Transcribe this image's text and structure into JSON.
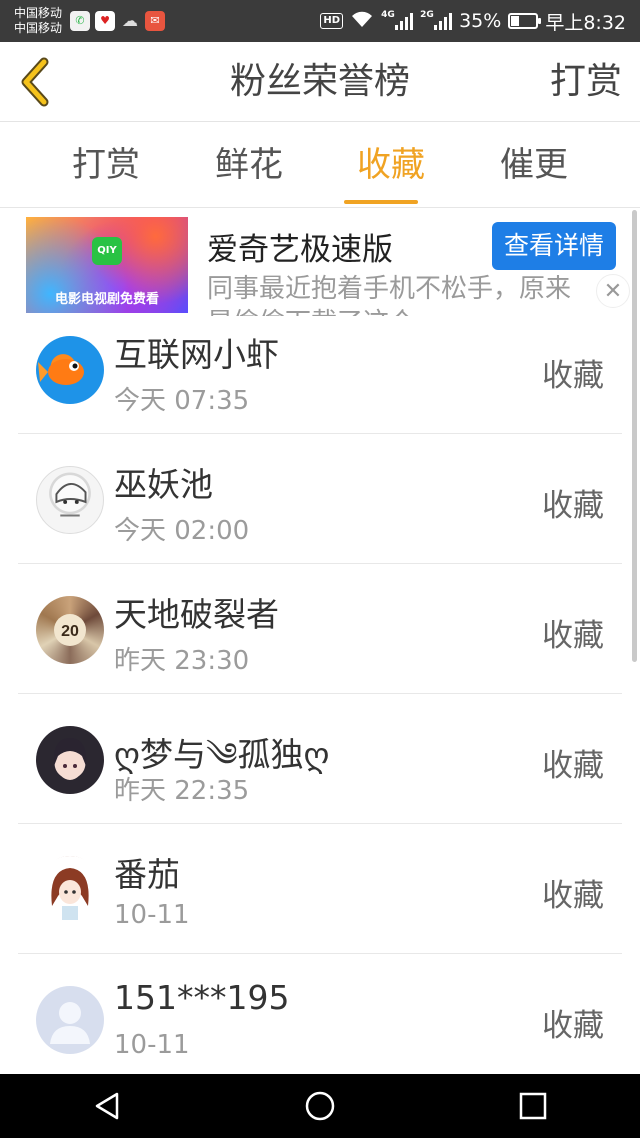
{
  "status_bar": {
    "carrier_1": "中国移动",
    "carrier_2": "中国移动",
    "app_icons": [
      "wechat-icon",
      "heart-icon",
      "cloud-icon",
      "mail-icon"
    ],
    "hd": "HD",
    "net_1": "4G",
    "net_2": "2G",
    "battery": "35%",
    "battery_level": 0.35,
    "time": "早上8:32"
  },
  "header": {
    "title": "粉丝荣誉榜",
    "action": "打赏"
  },
  "tabs": [
    {
      "label": "打赏",
      "active": false
    },
    {
      "label": "鲜花",
      "active": false
    },
    {
      "label": "收藏",
      "active": true
    },
    {
      "label": "催更",
      "active": false
    }
  ],
  "ad": {
    "title": "爱奇艺极速版",
    "cta": "查看详情",
    "desc_line_1": "同事最近抱着手机不松手，原来",
    "desc_line_2": "是偷偷下载了这个",
    "image_logo": "QIY",
    "image_caption": "电影电视剧免费看"
  },
  "list": [
    {
      "name": "互联网小虾",
      "time": "今天 07:35",
      "action": "收藏",
      "avatar": "fish"
    },
    {
      "name": "巫妖池",
      "time": "今天 02:00",
      "action": "收藏",
      "avatar": "sketch"
    },
    {
      "name": "天地破裂者",
      "time": "昨天 23:30",
      "action": "收藏",
      "avatar": "collage"
    },
    {
      "name": "ღ梦与༄孤独ღ",
      "time": "昨天 22:35",
      "action": "收藏",
      "avatar": "girl"
    },
    {
      "name": "番茄",
      "time": "10-11",
      "action": "收藏",
      "avatar": "chibi"
    },
    {
      "name": "151***195",
      "time": "10-11",
      "action": "收藏",
      "avatar": "default"
    }
  ],
  "colors": {
    "accent": "#f0a323",
    "cta": "#1e7ee6",
    "status_bar": "#3b3b3b"
  }
}
